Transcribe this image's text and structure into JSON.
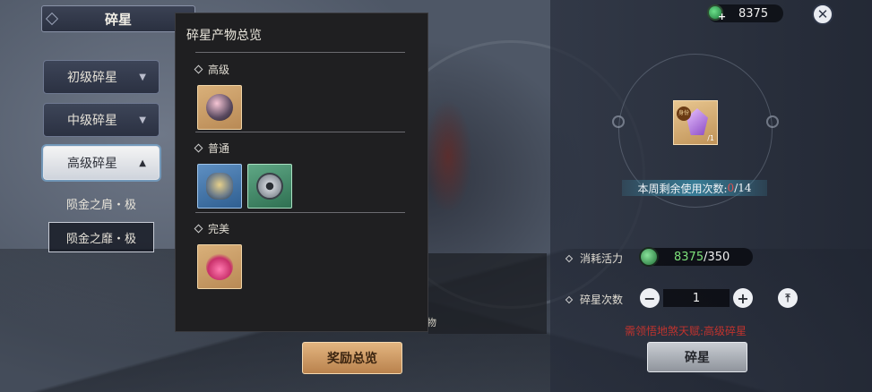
{
  "header": {
    "title": "碎星"
  },
  "tiers": [
    {
      "label": "初级碎星",
      "arrow": "▼"
    },
    {
      "label": "中级碎星",
      "arrow": "▼"
    },
    {
      "label": "高级碎星",
      "arrow": "▲"
    }
  ],
  "sub_items": [
    {
      "label": "陨金之肩・极"
    },
    {
      "label": "陨金之靡・极"
    }
  ],
  "popup": {
    "title": "碎星产物总览",
    "sections": [
      {
        "label": "高级"
      },
      {
        "label": "普通"
      },
      {
        "label": "完美"
      }
    ]
  },
  "background_text": "物",
  "buttons": {
    "rewards": "奖励总览",
    "shatter": "碎星"
  },
  "currency": {
    "value": "8375",
    "plus": "+"
  },
  "close": "✕",
  "center_item": {
    "badge": "身份",
    "count": "/1"
  },
  "week": {
    "prefix": "本周剩余使用次数:",
    "used": "0",
    "suffix": "/14"
  },
  "stamina": {
    "label": "消耗活力",
    "current": "8375",
    "max": "/350"
  },
  "shatter_count": {
    "label": "碎星次数",
    "value": "1",
    "minus": "−",
    "plus": "+",
    "max": "⤒"
  },
  "requirement": "需领悟地煞天赋:高级碎星",
  "colors": {
    "gold_slot": "#d9b07a",
    "blue_slot": "#4a7bb0",
    "green_slot": "#4d9474",
    "warning": "#c0332e",
    "stamina": "#7de07a"
  }
}
